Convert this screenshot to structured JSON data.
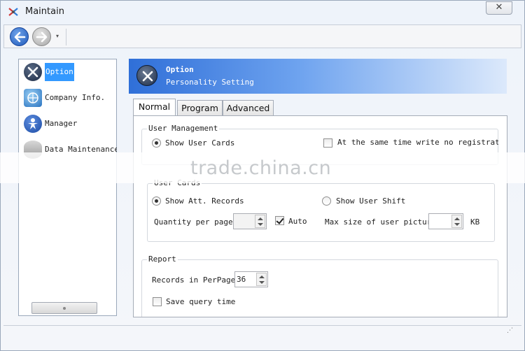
{
  "window": {
    "title": "Maintain",
    "close_label": "✕"
  },
  "toolbar": {
    "back_icon": "back-arrow-icon",
    "forward_icon": "forward-arrow-icon",
    "dropdown": "▾"
  },
  "sidebar": {
    "items": [
      {
        "label": "Option",
        "icon": "tools-icon",
        "selected": true
      },
      {
        "label": "Company Info.",
        "icon": "globe-icon",
        "selected": false
      },
      {
        "label": "Manager",
        "icon": "person-icon",
        "selected": false
      },
      {
        "label": "Data Maintenance",
        "icon": "database-icon",
        "selected": false
      }
    ]
  },
  "header": {
    "title": "Option",
    "subtitle": "Personality Setting"
  },
  "tabs": [
    {
      "label": "Normal",
      "active": true
    },
    {
      "label": "Program",
      "active": false
    },
    {
      "label": "Advanced",
      "active": false
    }
  ],
  "user_management": {
    "title": "User Management",
    "show_user_cards": "Show User Cards",
    "same_time_write": "At the same time write no registration"
  },
  "user_cards": {
    "title": "User Cards",
    "show_att_records": "Show Att. Records",
    "show_user_shift": "Show User Shift",
    "quantity_label": "Quantity per page",
    "quantity_value": "",
    "auto_label": "Auto",
    "auto_checked": true,
    "max_size_label": "Max size of user picture",
    "max_size_value": "",
    "kb_label": "KB"
  },
  "report": {
    "title": "Report",
    "records_label": "Records in PerPage",
    "records_value": "36",
    "save_query_label": "Save query time"
  },
  "watermark": "trade.china.cn",
  "colors": {
    "accent": "#3399ff",
    "header_start": "#2f6fd8",
    "header_end": "#dce9fb"
  }
}
